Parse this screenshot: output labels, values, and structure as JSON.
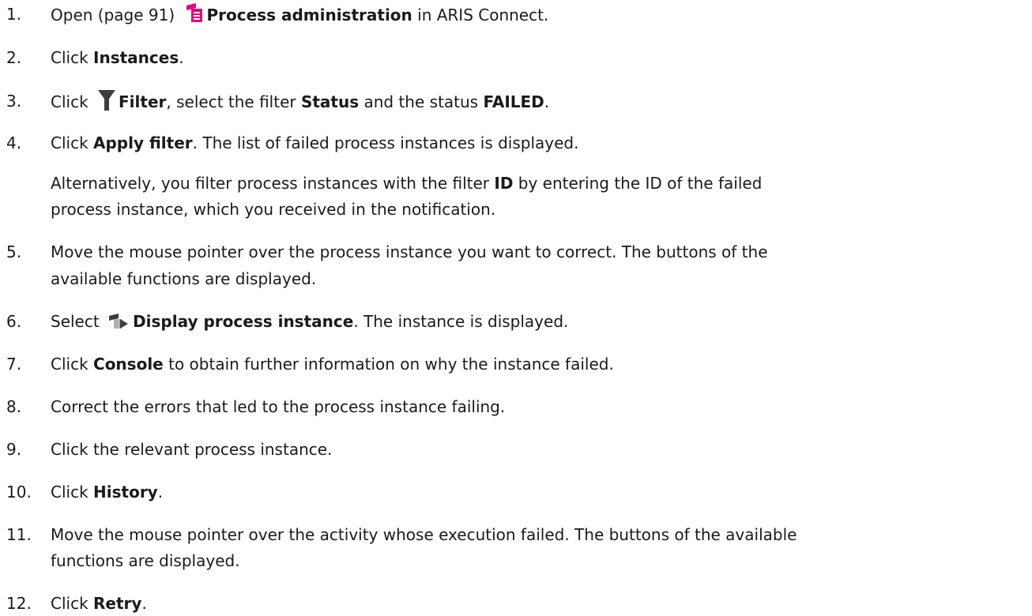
{
  "steps": [
    {
      "num": "1.",
      "t1": "Open (page 91) ",
      "b1": "Process administration",
      "t2": " in ARIS Connect.",
      "icon": "process-administration-icon"
    },
    {
      "num": "2.",
      "t1": "Click ",
      "b1": "Instances",
      "t2": "."
    },
    {
      "num": "3.",
      "t1": "Click ",
      "b1": "Filter",
      "t2": ", select the filter ",
      "b2": "Status",
      "t3": " and the status ",
      "b3": "FAILED",
      "t4": ".",
      "icon": "filter-icon"
    },
    {
      "num": "4.",
      "t1": "Click ",
      "b1": "Apply filter",
      "t2": ". The list of failed process instances is displayed."
    },
    {
      "t1": "Alternatively, you filter process instances with the filter ",
      "b1": "ID",
      "t2": " by entering the ID of the failed",
      "line2": "process instance, which you received in the notification."
    },
    {
      "num": "5.",
      "t1": "Move the mouse pointer over the process instance you want to correct. The buttons of the",
      "line2": "available functions are displayed."
    },
    {
      "num": "6.",
      "t1": "Select ",
      "b1": "Display process instance",
      "t2": ". The instance is displayed.",
      "icon": "display-process-instance-icon"
    },
    {
      "num": "7.",
      "t1": "Click ",
      "b1": "Console",
      "t2": " to obtain further information on why the instance failed."
    },
    {
      "num": "8.",
      "t1": "Correct the errors that led to the process instance failing."
    },
    {
      "num": "9.",
      "t1": "Click the relevant process instance."
    },
    {
      "num": "10.",
      "t1": "Click ",
      "b1": "History",
      "t2": "."
    },
    {
      "num": "11.",
      "t1": "Move the mouse pointer over the activity whose execution failed. The buttons of the available",
      "line2": "functions are displayed."
    },
    {
      "num": "12.",
      "t1": "Click ",
      "b1": "Retry",
      "t2": "."
    }
  ],
  "colors": {
    "icon_pink": "#e6007e",
    "icon_grey": "#3d3d3d",
    "icon_light": "#b0b0b0"
  }
}
